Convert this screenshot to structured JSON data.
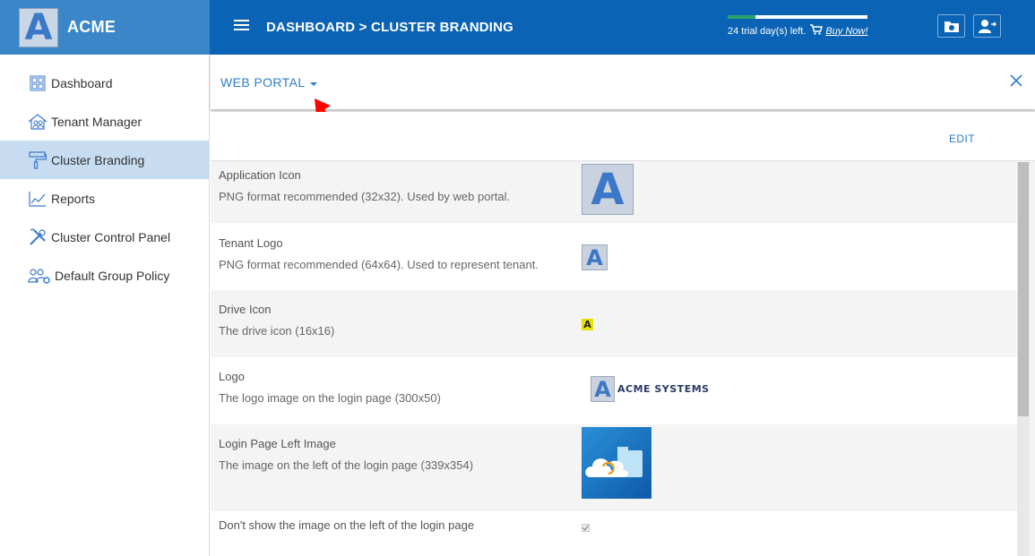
{
  "brand": {
    "letter": "A",
    "name": "ACME"
  },
  "header": {
    "breadcrumb": "DASHBOARD > CLUSTER BRANDING",
    "trial_text": "24 trial day(s) left.",
    "buy_link": "Buy Now!",
    "trial_progress_fraction": 0.2
  },
  "sidebar": {
    "items": [
      {
        "label": "Dashboard",
        "icon": "dashboard-grid-icon",
        "active": false
      },
      {
        "label": "Tenant Manager",
        "icon": "house-people-icon",
        "active": false
      },
      {
        "label": "Cluster Branding",
        "icon": "paint-roller-icon",
        "active": true
      },
      {
        "label": "Reports",
        "icon": "chart-line-icon",
        "active": false
      },
      {
        "label": "Cluster Control Panel",
        "icon": "tools-icon",
        "active": false
      },
      {
        "label": "Default Group Policy",
        "icon": "group-gear-icon",
        "active": false
      }
    ]
  },
  "panel": {
    "title": "WEB PORTAL",
    "edit_label": "EDIT"
  },
  "rows": [
    {
      "name": "Application Icon",
      "desc": "PNG format recommended (32x32). Used by web portal."
    },
    {
      "name": "Tenant Logo",
      "desc": "PNG format recommended (64x64). Used to represent tenant."
    },
    {
      "name": "Drive Icon",
      "desc": "The drive icon (16x16)"
    },
    {
      "name": "Logo",
      "desc": "The logo image on the login page (300x50)",
      "logo_text": "ACME SYSTEMS",
      "logo_letter": "A"
    },
    {
      "name": "Login Page Left Image",
      "desc": "The image on the left of the login page (339x354)"
    },
    {
      "name": "Don't show the image on the left of the login page",
      "checked": true
    }
  ],
  "colors": {
    "topbar": "#0a63b5",
    "brand_bg": "#3a86c8",
    "accent": "#2f7ec8",
    "active_nav": "#c7dcf0"
  }
}
